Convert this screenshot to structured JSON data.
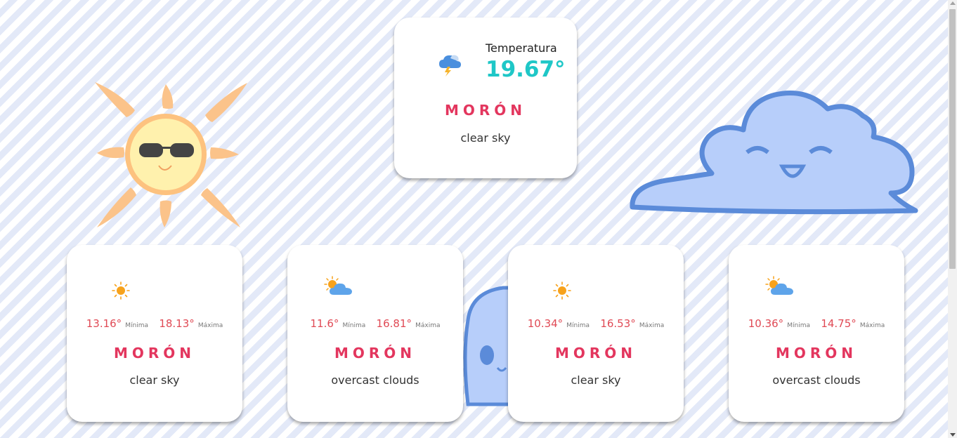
{
  "current": {
    "icon": "thunderstorm-icon",
    "temp_label": "Temperatura",
    "temp_value": "19.67°",
    "city": "MORÓN",
    "description": "clear sky"
  },
  "forecast": [
    {
      "icon": "sun-icon",
      "min": "13.16°",
      "min_label": "Mínima",
      "max": "18.13°",
      "max_label": "Máxima",
      "city": "MORÓN",
      "description": "clear sky"
    },
    {
      "icon": "partly-cloudy-icon",
      "min": "11.6°",
      "min_label": "Mínima",
      "max": "16.81°",
      "max_label": "Máxima",
      "city": "MORÓN",
      "description": "overcast clouds"
    },
    {
      "icon": "sun-icon",
      "min": "10.34°",
      "min_label": "Mínima",
      "max": "16.53°",
      "max_label": "Máxima",
      "city": "MORÓN",
      "description": "clear sky"
    },
    {
      "icon": "partly-cloudy-icon",
      "min": "10.36°",
      "min_label": "Mínima",
      "max": "14.75°",
      "max_label": "Máxima",
      "city": "MORÓN",
      "description": "overcast clouds"
    }
  ],
  "colors": {
    "city": "#e3365e",
    "temp": "#1fc7c7",
    "minmax": "#e04a55"
  }
}
